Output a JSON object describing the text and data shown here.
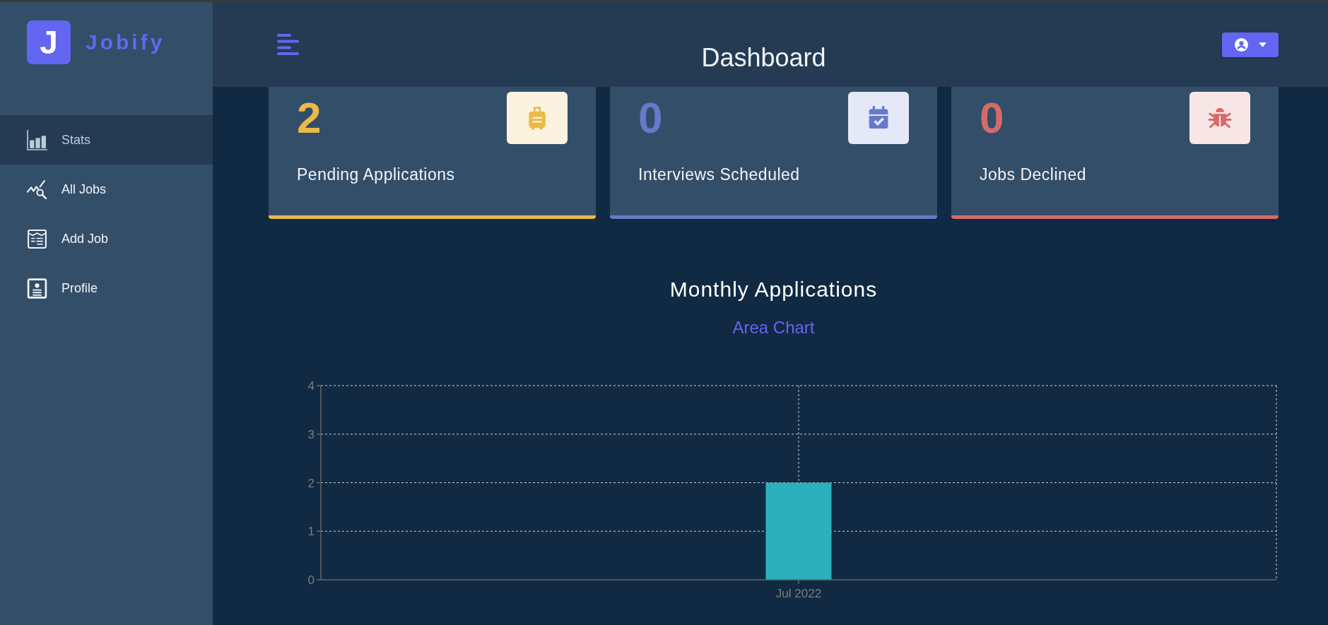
{
  "sidebar": {
    "logo": {
      "letter": "J",
      "name": "Jobify"
    },
    "items": [
      {
        "label": "Stats",
        "selected": true
      },
      {
        "label": "All Jobs",
        "selected": false
      },
      {
        "label": "Add Job",
        "selected": false
      },
      {
        "label": "Profile",
        "selected": false
      }
    ]
  },
  "header": {
    "title": "Dashboard"
  },
  "stats": [
    {
      "count": "2",
      "label": "Pending Applications",
      "color": "#e9b949"
    },
    {
      "count": "0",
      "label": "Interviews Scheduled",
      "color": "#647acb"
    },
    {
      "count": "0",
      "label": "Jobs Declined",
      "color": "#d66a6a"
    }
  ],
  "chart_section": {
    "toggle_button": "Area Chart",
    "chart_data": {
      "type": "bar",
      "title": "Monthly Applications",
      "categories": [
        "Jul 2022"
      ],
      "values": [
        2
      ],
      "ylim": [
        0,
        4
      ],
      "yticks": [
        0,
        1,
        2,
        3,
        4
      ],
      "grid": true
    }
  }
}
